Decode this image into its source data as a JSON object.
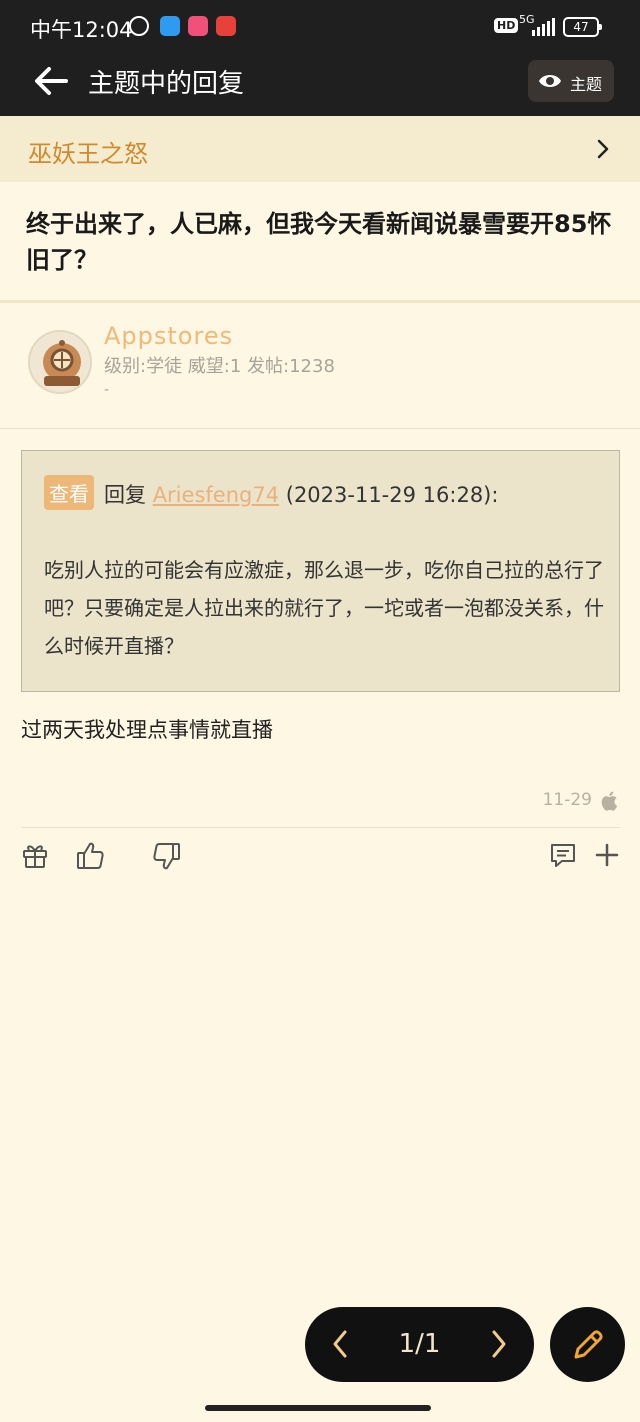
{
  "status_bar": {
    "time": "中午12:04",
    "network": "5G",
    "hd": "HD",
    "battery": "47"
  },
  "header": {
    "title": "主题中的回复",
    "topic_button_label": "主题"
  },
  "forum": {
    "name": "巫妖王之怒"
  },
  "thread": {
    "title": "终于出来了，人已麻，但我今天看新闻说暴雪要开85怀旧了？"
  },
  "author": {
    "name": "Appstores",
    "meta": "级别:学徒 威望:1 发帖:1238",
    "signature": "-"
  },
  "quote": {
    "tag": "查看",
    "reply_prefix": "回复",
    "user": "Ariesfeng74",
    "time": "(2023-11-29 16:28):",
    "body": "吃别人拉的可能会有应激症，那么退一步，吃你自己拉的总行了吧？只要确定是人拉出来的就行了，一坨或者一泡都没关系，什么时候开直播？"
  },
  "post": {
    "text": "过两天我处理点事情就直播",
    "date": "11-29"
  },
  "pager": {
    "label": "1/1"
  },
  "colors": {
    "background": "#fdf7e3",
    "topbar": "#1f1f1f",
    "accent": "#d08a2e",
    "author": "#f0b978"
  },
  "icons": {
    "back": "arrow-left-icon",
    "eye": "eye-icon",
    "chevron": "chevron-right-icon",
    "gift": "gift-icon",
    "like": "thumbs-up-icon",
    "dislike": "thumbs-down-icon",
    "comment": "comment-icon",
    "add": "plus-icon",
    "edit": "pencil-icon",
    "device": "apple-icon"
  }
}
